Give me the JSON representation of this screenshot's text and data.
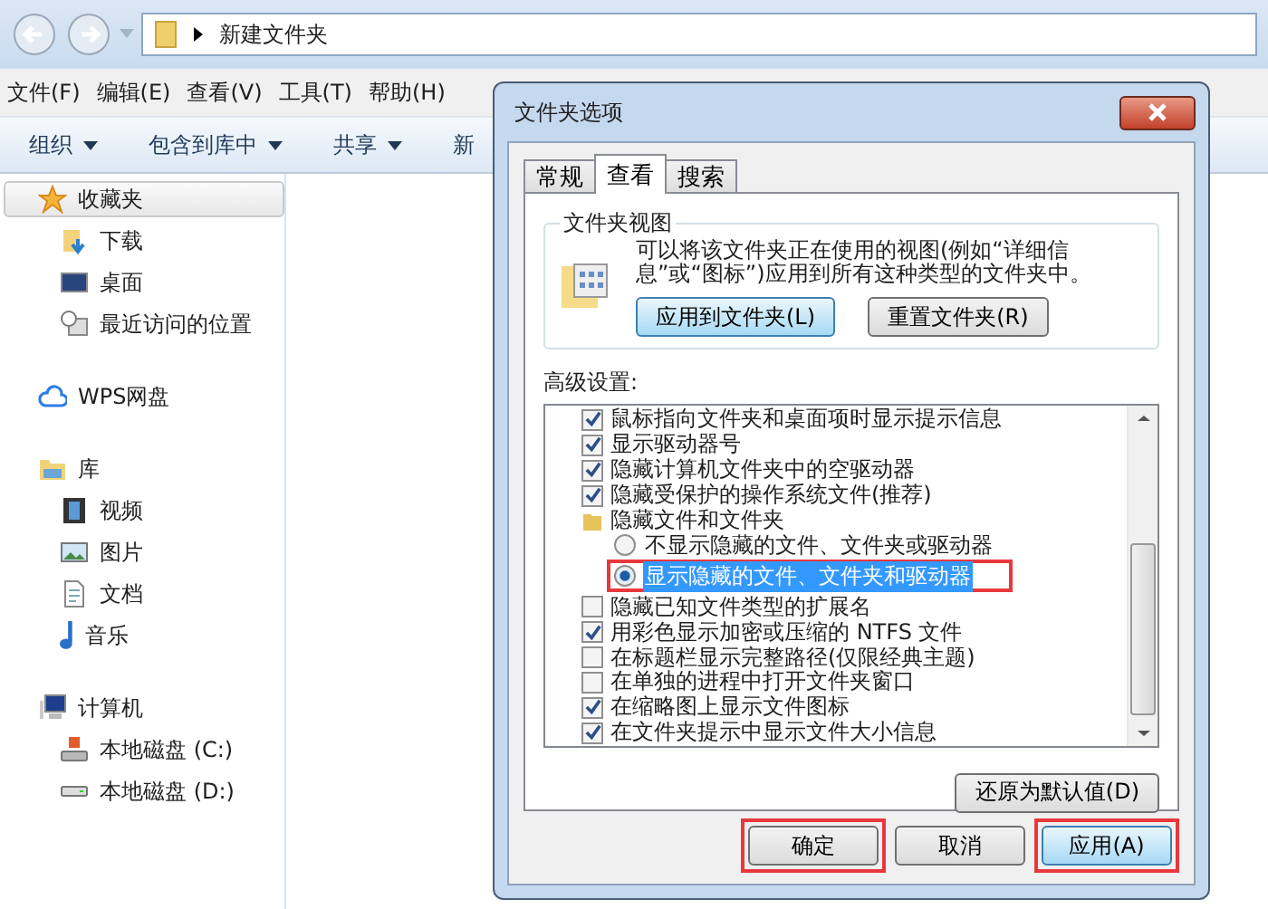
{
  "explorer": {
    "path": "新建文件夹",
    "menu": [
      "文件(F)",
      "编辑(E)",
      "查看(V)",
      "工具(T)",
      "帮助(H)"
    ],
    "toolbar": [
      {
        "label": "组织",
        "dropdown": true
      },
      {
        "label": "包含到库中",
        "dropdown": true
      },
      {
        "label": "共享",
        "dropdown": true
      },
      {
        "label": "新",
        "dropdown": false
      }
    ],
    "sidebar": [
      {
        "kind": "star",
        "label": "收藏夹",
        "selected": true,
        "children": [
          {
            "kind": "download",
            "label": "下载",
            "selected": false
          },
          {
            "kind": "desktop",
            "label": "桌面",
            "selected": false
          },
          {
            "kind": "recent",
            "label": "最近访问的位置",
            "selected": false
          }
        ]
      },
      {
        "kind": "cloud",
        "label": "WPS网盘",
        "selected": false
      },
      {
        "kind": "library",
        "label": "库",
        "selected": false,
        "children": [
          {
            "kind": "video",
            "label": "视频",
            "selected": false
          },
          {
            "kind": "image",
            "label": "图片",
            "selected": false
          },
          {
            "kind": "document",
            "label": "文档",
            "selected": false
          },
          {
            "kind": "music",
            "label": "音乐",
            "selected": false
          }
        ]
      },
      {
        "kind": "computer",
        "label": "计算机",
        "selected": false,
        "children": [
          {
            "kind": "systemdrive",
            "label": "本地磁盘 (C:)",
            "selected": false
          },
          {
            "kind": "drive",
            "label": "本地磁盘 (D:)",
            "selected": false
          }
        ]
      }
    ]
  },
  "dialog": {
    "title": "文件夹选项",
    "tabs": [
      {
        "label": "常规",
        "selected": false
      },
      {
        "label": "查看",
        "selected": true
      },
      {
        "label": "搜索",
        "selected": false
      }
    ],
    "folder_views": {
      "legend": "文件夹视图",
      "description": "可以将该文件夹正在使用的视图(例如“详细信息”或“图标”)应用到所有这种类型的文件夹中。",
      "buttons": [
        "应用到文件夹(L)",
        "重置文件夹(R)"
      ]
    },
    "advanced": {
      "label": "高级设置:",
      "items": [
        {
          "kind": "checkbox",
          "label": "鼠标指向文件夹和桌面项时显示提示信息",
          "checked": true
        },
        {
          "kind": "checkbox",
          "label": "显示驱动器号",
          "checked": true
        },
        {
          "kind": "checkbox",
          "label": "隐藏计算机文件夹中的空驱动器",
          "checked": true
        },
        {
          "kind": "checkbox",
          "label": "隐藏受保护的操作系统文件(推荐)",
          "checked": true
        },
        {
          "kind": "folder",
          "label": "隐藏文件和文件夹",
          "children": [
            {
              "kind": "radio",
              "label": "不显示隐藏的文件、文件夹或驱动器",
              "selected": false,
              "highlighted": false
            },
            {
              "kind": "radio",
              "label": "显示隐藏的文件、文件夹和驱动器",
              "selected": true,
              "highlighted": true
            }
          ]
        },
        {
          "kind": "checkbox",
          "label": "隐藏已知文件类型的扩展名",
          "checked": false
        },
        {
          "kind": "checkbox",
          "label": "用彩色显示加密或压缩的 NTFS 文件",
          "checked": true
        },
        {
          "kind": "checkbox",
          "label": "在标题栏显示完整路径(仅限经典主题)",
          "checked": false
        },
        {
          "kind": "checkbox",
          "label": "在单独的进程中打开文件夹窗口",
          "checked": false
        },
        {
          "kind": "checkbox",
          "label": "在缩略图上显示文件图标",
          "checked": true
        },
        {
          "kind": "checkbox",
          "label": "在文件夹提示中显示文件大小信息",
          "checked": true
        }
      ]
    },
    "restore_button": "还原为默认值(D)",
    "footer_buttons": [
      {
        "label": "确定",
        "highlighted": true
      },
      {
        "label": "取消",
        "highlighted": false
      },
      {
        "label": "应用(A)",
        "highlighted": true
      }
    ]
  }
}
